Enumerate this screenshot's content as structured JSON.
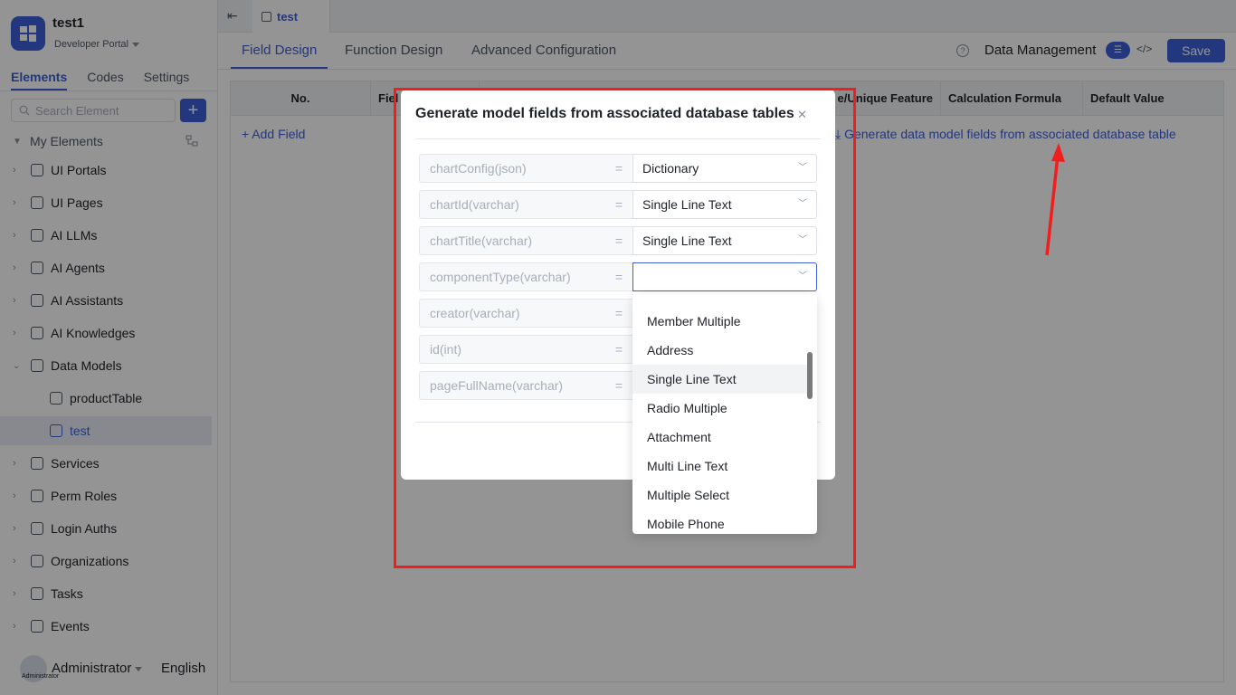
{
  "app": {
    "name": "test1",
    "subtitle": "Developer Portal"
  },
  "sidebar": {
    "tabs": [
      {
        "label": "Elements",
        "active": true
      },
      {
        "label": "Codes",
        "active": false
      },
      {
        "label": "Settings",
        "active": false
      }
    ],
    "search_placeholder": "Search Element",
    "add_label": "+",
    "root_label": "My Elements",
    "items": [
      {
        "label": "UI Portals",
        "icon": "home-icon"
      },
      {
        "label": "UI Pages",
        "icon": "pages-icon"
      },
      {
        "label": "AI LLMs",
        "icon": "llm-icon"
      },
      {
        "label": "AI Agents",
        "icon": "robot-icon"
      },
      {
        "label": "AI Assistants",
        "icon": "assistant-icon"
      },
      {
        "label": "AI Knowledges",
        "icon": "book-icon"
      },
      {
        "label": "Data Models",
        "icon": "table-icon"
      },
      {
        "label": "productTable",
        "icon": "table-icon"
      },
      {
        "label": "test",
        "icon": "table-icon"
      },
      {
        "label": "Services",
        "icon": "services-icon"
      },
      {
        "label": "Perm Roles",
        "icon": "roles-icon"
      },
      {
        "label": "Login Auths",
        "icon": "auth-icon"
      },
      {
        "label": "Organizations",
        "icon": "org-icon"
      },
      {
        "label": "Tasks",
        "icon": "tasks-icon"
      },
      {
        "label": "Events",
        "icon": "events-icon"
      }
    ],
    "user": "Administrator",
    "user_caption": "Administrator",
    "language": "English"
  },
  "topbar": {
    "tab": "test"
  },
  "nav": {
    "tabs": [
      "Field Design",
      "Function Design",
      "Advanced Configuration"
    ],
    "help": "?",
    "data_management": "Data Management",
    "save": "Save"
  },
  "table": {
    "headers": [
      "No.",
      "Fiel",
      "e/Unique Feature",
      "Calculation Formula",
      "Default Value"
    ],
    "add_field": "+ Add Field",
    "generate_link": "Generate data model fields from associated database table"
  },
  "modal": {
    "title": "Generate model fields from associated database tables",
    "equals": "=",
    "rows": [
      {
        "column": "chartConfig(json)",
        "type": "Dictionary"
      },
      {
        "column": "chartId(varchar)",
        "type": "Single Line Text"
      },
      {
        "column": "chartTitle(varchar)",
        "type": "Single Line Text"
      },
      {
        "column": "componentType(varchar)",
        "type": ""
      },
      {
        "column": "creator(varchar)",
        "type": ""
      },
      {
        "column": "id(int)",
        "type": ""
      },
      {
        "column": "pageFullName(varchar)",
        "type": ""
      }
    ],
    "dropdown_options": [
      "Member Multiple",
      "Address",
      "Single Line Text",
      "Radio Multiple",
      "Attachment",
      "Multi Line Text",
      "Multiple Select",
      "Mobile Phone"
    ],
    "hovered_option": "Single Line Text"
  },
  "colors": {
    "accent": "#3d5fd9",
    "highlight": "#f21e1e"
  }
}
